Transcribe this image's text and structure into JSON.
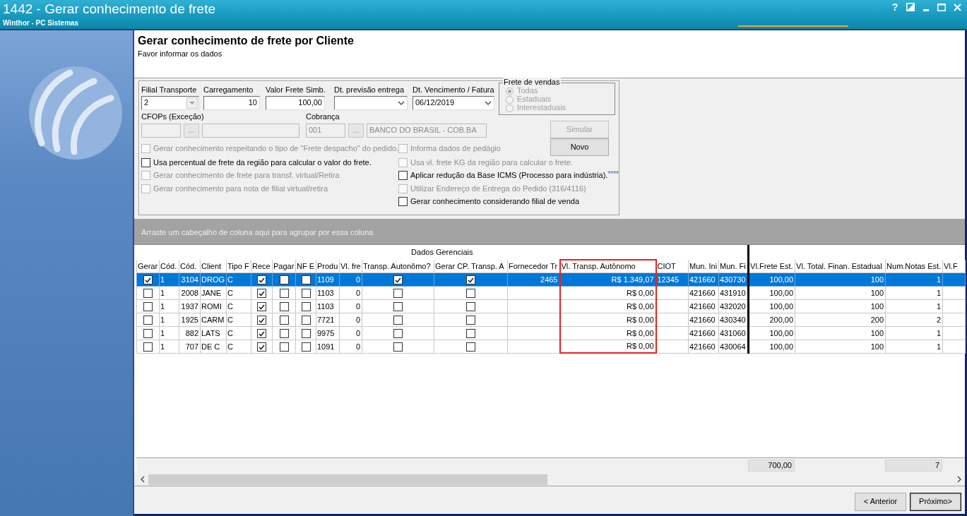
{
  "window": {
    "title": "1442 - Gerar conhecimento de frete",
    "subtitle": "Winthor - PC Sistemas",
    "help": "?"
  },
  "header": {
    "title": "Gerar conhecimento de frete por Cliente",
    "subtitle": "Favor informar os dados"
  },
  "form": {
    "fields": [
      {
        "label": "Filial Transporte",
        "kind": "select",
        "value": "2"
      },
      {
        "label": "Carregamento",
        "kind": "number",
        "value": "10"
      },
      {
        "label": "Valor Frete Simb.",
        "kind": "number",
        "value": "100,00"
      },
      {
        "label": "Dt. previsão entrega",
        "kind": "date"
      },
      {
        "label": "Dt. Vencimento / Fatura",
        "kind": "date",
        "value": "06/12/2019"
      }
    ],
    "lookups": [
      {
        "label": "CFOPs (Exceção)",
        "button": "...",
        "disabled": true
      },
      {
        "label": "Cobrança",
        "code": "001",
        "button": "...",
        "description": "BANCO DO BRASIL - COB.BA",
        "disabled": true
      }
    ],
    "sales_freight": {
      "title": "Frete de vendas",
      "options": [
        {
          "label": "Todas",
          "selected": true,
          "disabled": true
        },
        {
          "label": "Estaduais",
          "selected": false,
          "disabled": true
        },
        {
          "label": "Interestaduais",
          "selected": false,
          "disabled": true
        }
      ]
    },
    "actions": [
      {
        "label": "Simular",
        "disabled": true
      },
      {
        "label": "Novo",
        "disabled": false
      }
    ],
    "options_left": [
      {
        "label": "Gerar conhecimento respeitando o tipo de \"Frete despacho\" do pedido.",
        "checked": false,
        "disabled": true
      },
      {
        "label": "Usa percentual de frete da região para calcular o valor do frete.",
        "checked": false,
        "disabled": false
      },
      {
        "label": "Gerar conhecimento de frete para transf. virtual/Retira",
        "checked": false,
        "disabled": true
      },
      {
        "label": "Gerar conhecimento para nota de filial virtual/retira",
        "checked": false,
        "disabled": true
      }
    ],
    "options_right": [
      {
        "label": "Informa dados de pedágio",
        "checked": false,
        "disabled": true
      },
      {
        "label": "Usa vl. frete KG da região para calcular o frete.",
        "checked": false,
        "disabled": true
      },
      {
        "label": "Aplicar redução da Base ICMS (Processo para indústria).",
        "note": "****",
        "checked": false,
        "disabled": false
      },
      {
        "label": "Utilizar Endereço de Entrega do Pedido (316/4116)",
        "checked": false,
        "disabled": true
      },
      {
        "label": "Gerar conhecimento considerando filial de venda",
        "checked": false,
        "disabled": false
      }
    ]
  },
  "grid": {
    "group_hint": "Arraste um cabeçalho de coluna aqui para agrupar por essa coluna",
    "column_groups": [
      {
        "label": "Dados Gerenciais",
        "columns": [
          {
            "label": "Gerar",
            "kind": "check",
            "highlighted": false
          },
          {
            "label": "Cód.",
            "kind": "text",
            "highlighted": false
          },
          {
            "label": "Cód.",
            "kind": "number",
            "highlighted": false
          },
          {
            "label": "Client",
            "kind": "text",
            "highlighted": false
          },
          {
            "label": "Tipo F",
            "kind": "text",
            "highlighted": false
          },
          {
            "label": "Rece",
            "kind": "check",
            "highlighted": false
          },
          {
            "label": "Pagar",
            "kind": "check",
            "highlighted": false
          },
          {
            "label": "NF E",
            "kind": "check",
            "highlighted": false
          },
          {
            "label": "Produ",
            "kind": "text",
            "highlighted": false
          },
          {
            "label": "Vl. fre",
            "kind": "number",
            "highlighted": false
          },
          {
            "label": "Transp. Autonômo?",
            "kind": "check",
            "highlighted": false
          },
          {
            "label": "Gerar CP. Transp. A",
            "kind": "check",
            "highlighted": false
          },
          {
            "label": "Fornecedor Tr",
            "kind": "number",
            "highlighted": false
          },
          {
            "label": "Vl. Transp. Autônomo",
            "kind": "number",
            "highlighted": true
          },
          {
            "label": "CIOT",
            "kind": "text",
            "highlighted": false
          },
          {
            "label": "Mun. Ini",
            "kind": "text",
            "highlighted": false
          },
          {
            "label": "Mun. Fi",
            "kind": "text",
            "highlighted": false
          }
        ]
      },
      {
        "columns": [
          {
            "label": "Vl.Frete Est.",
            "kind": "number",
            "highlighted": false,
            "total": "700,00"
          },
          {
            "label": "Vl. Total. Finan. Estadual",
            "kind": "number",
            "highlighted": false
          },
          {
            "label": "Num.Notas Est.",
            "kind": "number",
            "highlighted": false,
            "total": "7"
          },
          {
            "label": "Vl.F",
            "kind": "number",
            "highlighted": false
          }
        ]
      }
    ],
    "rows": [
      {
        "selected": true,
        "cells": [
          true,
          "1",
          "3104",
          "DROG",
          "C",
          true,
          false,
          false,
          "1109",
          "0",
          true,
          true,
          "2465",
          "R$ 1.349,07",
          "12345",
          "421660",
          "430730",
          "100,00",
          "100",
          "1",
          null
        ]
      },
      {
        "selected": false,
        "cells": [
          false,
          "1",
          "2008",
          "JANE",
          "C",
          true,
          false,
          false,
          "1103",
          "0",
          false,
          false,
          null,
          "R$ 0,00",
          null,
          "421660",
          "431910",
          "100,00",
          "100",
          "1",
          null
        ]
      },
      {
        "selected": false,
        "cells": [
          false,
          "1",
          "1937",
          "ROMI",
          "C",
          true,
          false,
          false,
          "1103",
          "0",
          false,
          false,
          null,
          "R$ 0,00",
          null,
          "421660",
          "432020",
          "100,00",
          "100",
          "1",
          null
        ]
      },
      {
        "selected": false,
        "cells": [
          false,
          "1",
          "1925",
          "CARM",
          "C",
          true,
          false,
          false,
          "7721",
          "0",
          false,
          false,
          null,
          "R$ 0,00",
          null,
          "421660",
          "430340",
          "200,00",
          "200",
          "2",
          null
        ]
      },
      {
        "selected": false,
        "cells": [
          false,
          "1",
          "882",
          "LATS",
          "C",
          true,
          false,
          false,
          "9975",
          "0",
          false,
          false,
          null,
          "R$ 0,00",
          null,
          "421660",
          "431060",
          "100,00",
          "100",
          "1",
          null
        ]
      },
      {
        "selected": false,
        "cells": [
          false,
          "1",
          "707",
          "DE C",
          "C",
          true,
          false,
          false,
          "1091",
          "0",
          false,
          false,
          null,
          "R$ 0,00",
          null,
          "421660",
          "430064",
          "100,00",
          "100",
          "1",
          null
        ]
      }
    ]
  },
  "nav_buttons": [
    {
      "label": "< Anterior",
      "default": false
    },
    {
      "label": "Próximo>",
      "default": true
    }
  ]
}
